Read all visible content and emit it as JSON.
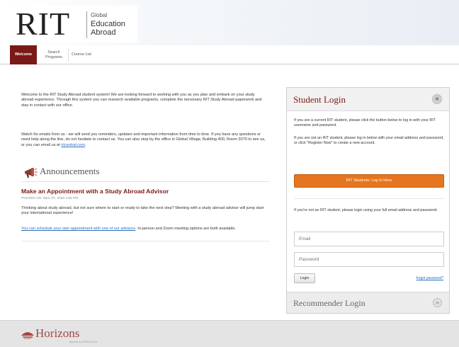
{
  "header": {
    "logo_main": "RIT",
    "logo_line1": "Global",
    "logo_line2": "Education",
    "logo_line3": "Abroad"
  },
  "tabs": [
    {
      "label": "Welcome",
      "active": true
    },
    {
      "label": "Search Programs",
      "active": false
    },
    {
      "label": "Course List",
      "active": false
    }
  ],
  "main": {
    "intro_text": "Welcome to the RIT Study Abroad student system! We are looking forward to working with you as you plan and embark on your study abroad experience. Through this system you can research available programs, complete the necessary RIT Study Abroad paperwork and stay in contact with our office.",
    "intro2_text": "Watch for emails from us - we will send you reminders, updates and important information from time to time. If you have any questions or need help along the line, do not hesitate to contact us. You can also stop by the office in Global Village, Building 400, Room 2070 to see us, or you can email us at",
    "intro2_link": "ritcentral.com"
  },
  "announcements": {
    "heading": "Announcements",
    "post_title": "Make an Appointment with a Study Abroad Advisor",
    "post_date": "POSTED ON: DEC 07, 2020 4:55 PM",
    "post_body": "Thinking about study abroad, but not sure where to start or ready to take the next step? Meeting with a study abroad advisor will jump start your international experience!",
    "post_link": "You can schedule your own appointment with one of our advisors",
    "post_body2": ". In-person and Zoom meeting options are both available."
  },
  "login_panel": {
    "title": "Student Login",
    "toggle": "«",
    "text1": "If you are a current RIT student, please click the button below to log in with your RIT username and password.",
    "text2": "If you are not an RIT student, please log in below with your email address and password, or click \"Register Now\" to create a new account.",
    "sso_button": "RIT Students: Log In Here",
    "text3": "If you're not an RIT student, please login using your full email address and password.",
    "email_placeholder": "Email",
    "password_placeholder": "Password",
    "login_button": "Login",
    "forgot_link": "forgot password?"
  },
  "recommender": {
    "title": "Recommender Login",
    "toggle": "»"
  },
  "footer": {
    "brand": "Horizons",
    "tagline": "powered by TERRA DOTTA"
  },
  "colors": {
    "brand_maroon": "#7a1a16",
    "button_orange": "#e5751f",
    "link_blue": "#2a6fbf"
  }
}
